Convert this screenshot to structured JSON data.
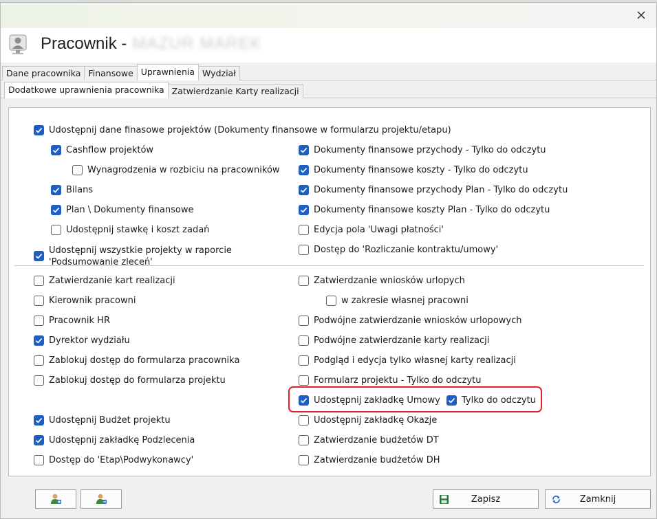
{
  "window": {
    "title_prefix": "Pracownik -",
    "title_name_blurred": "MAZUR MAREK"
  },
  "tabs": [
    {
      "label": "Dane pracownika",
      "active": false
    },
    {
      "label": "Finansowe",
      "active": false
    },
    {
      "label": "Uprawnienia",
      "active": true
    },
    {
      "label": "Wydział",
      "active": false
    }
  ],
  "subtabs": [
    {
      "label": "Dodatkowe uprawnienia pracownika",
      "active": true
    },
    {
      "label": "Zatwierdzanie Karty realizacji",
      "active": false
    }
  ],
  "permissions_top": [
    {
      "label": "Udostępnij dane finasowe projektów (Dokumenty finansowe w formularzu projektu/etapu)",
      "checked": true
    },
    {
      "label": "Cashflow projektów",
      "checked": true
    },
    {
      "label": "Wynagrodzenia w rozbiciu na pracowników",
      "checked": false
    },
    {
      "label": "Bilans",
      "checked": true
    },
    {
      "label": "Plan \\ Dokumenty finansowe",
      "checked": true
    },
    {
      "label": "Udostępnij stawkę i koszt zadań",
      "checked": false
    },
    {
      "label": "Udostępnij wszystkie projekty w raporcie 'Podsumowanie zleceń'",
      "checked": true
    },
    {
      "label": "Dokumenty finansowe przychody - Tylko do odczytu",
      "checked": true
    },
    {
      "label": "Dokumenty finansowe koszty - Tylko do odczytu",
      "checked": true
    },
    {
      "label": "Dokumenty finansowe przychody Plan - Tylko do odczytu",
      "checked": true
    },
    {
      "label": "Dokumenty finansowe koszty Plan - Tylko do odczytu",
      "checked": true
    },
    {
      "label": "Edycja pola 'Uwagi płatności'",
      "checked": false
    },
    {
      "label": "Dostęp do 'Rozliczanie kontraktu/umowy'",
      "checked": false
    }
  ],
  "permissions_bottom": [
    {
      "label": "Zatwierdzanie kart realizacji",
      "checked": false
    },
    {
      "label": "Kierownik pracowni",
      "checked": false
    },
    {
      "label": "Pracownik HR",
      "checked": false
    },
    {
      "label": "Dyrektor wydziału",
      "checked": true
    },
    {
      "label": "Zablokuj dostęp do formularza pracownika",
      "checked": false
    },
    {
      "label": "Zablokuj dostęp do formularza projektu",
      "checked": false
    },
    {
      "label": "Udostępnij Budżet projektu",
      "checked": true
    },
    {
      "label": "Udostępnij zakładkę Podzlecenia",
      "checked": true
    },
    {
      "label": "Dostęp do 'Etap\\Podwykonawcy'",
      "checked": false
    },
    {
      "label": "Zatwierdzanie wniosków urlopych",
      "checked": false
    },
    {
      "label": "w zakresie własnej pracowni",
      "checked": false
    },
    {
      "label": "Podwójne zatwierdzanie wniosków urlopowych",
      "checked": false
    },
    {
      "label": "Podwójne zatwierdzanie karty realizacji",
      "checked": false
    },
    {
      "label": "Podgląd i edycja tylko własnej karty realizacji",
      "checked": false
    },
    {
      "label": "Formularz projektu - Tylko do odczytu",
      "checked": false
    },
    {
      "label": "Udostępnij zakładkę Umowy",
      "checked": true
    },
    {
      "label": "Tylko do odczytu",
      "checked": true
    },
    {
      "label": "Udostępnij zakładkę Okazje",
      "checked": false
    },
    {
      "label": "Zatwierdzanie budżetów DT",
      "checked": false
    },
    {
      "label": "Zatwierdzanie budżetów DH",
      "checked": false
    }
  ],
  "buttons": {
    "save": "Zapisz",
    "close": "Zamknij"
  },
  "icons": [
    "close-icon",
    "user-silhouette-icon",
    "user-add-icon",
    "user-remove-icon",
    "floppy-disk-icon",
    "refresh-icon"
  ],
  "colors": {
    "checkbox_checked": "#1d5fc4",
    "highlight_border": "#e8202a"
  }
}
